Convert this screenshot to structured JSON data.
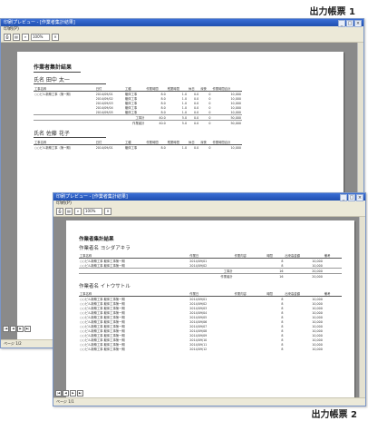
{
  "caption_top": "出力帳票 1",
  "caption_bottom": "出力帳票 2",
  "win1": {
    "title": "印刷プレビュー - [作業者集計結果]",
    "menu": "印刷(P)",
    "zoom": "100%",
    "report_title": "作業者集計結果",
    "section1_name": "氏名  田中  太一",
    "section2_name": "氏名  佐藤  花子",
    "columns": [
      "工事名称",
      "日付",
      "工種",
      "作業時間",
      "残業時間",
      "休日",
      "深夜",
      "作業時間合計"
    ],
    "rows": [
      [
        "○○ビル新築工事（第一期）",
        "2014/09/01",
        "躯体工事",
        "8.0",
        "1.0",
        "0.0",
        "0",
        "10,000"
      ],
      [
        "",
        "2014/09/02",
        "躯体工事",
        "8.0",
        "1.0",
        "0.0",
        "0",
        "10,000"
      ],
      [
        "",
        "2014/09/03",
        "躯体工事",
        "8.0",
        "1.0",
        "0.0",
        "0",
        "10,000"
      ],
      [
        "",
        "2014/09/04",
        "躯体工事",
        "8.0",
        "1.0",
        "0.0",
        "0",
        "10,000"
      ],
      [
        "",
        "2014/09/05",
        "躯体工事",
        "8.0",
        "1.0",
        "0.0",
        "0",
        "10,000"
      ]
    ],
    "subtotal_label": "工事計",
    "total_label": "作業者計",
    "subtotal": [
      "40.0",
      "5.0",
      "0.0",
      "0",
      "50,000"
    ],
    "total": [
      "40.0",
      "5.0",
      "0.0",
      "0",
      "50,000"
    ],
    "sec2_row": [
      "○○ビル新築工事（第一期）",
      "2014/09/01",
      "躯体工事",
      "8.0",
      "1.0",
      "0.0",
      "0",
      "10,000"
    ],
    "status": "ページ 1/2"
  },
  "win2": {
    "title": "印刷プレビュー - [作業者集計結果]",
    "menu": "印刷(P)",
    "zoom": "100%",
    "report_title": "作業者集計結果",
    "section1_name": "作業者名   ヨシダアキラ",
    "section2_name": "作業者名   イトウサトル",
    "columns": [
      "工事名称",
      "作業日",
      "作業内容",
      "時間",
      "出来高金額",
      "備考"
    ],
    "rows1": [
      [
        "○○ビル新築工事 躯体工事第一期",
        "2014/09/01",
        "",
        "8",
        "10,000",
        ""
      ],
      [
        "○○ビル新築工事 躯体工事第一期",
        "2014/09/02",
        "",
        "8",
        "10,000",
        ""
      ]
    ],
    "sub1_label": "工事計",
    "sub1": [
      "",
      "16",
      "20,000",
      ""
    ],
    "total1_label": "作業者計",
    "total1": [
      "",
      "16",
      "20,000",
      ""
    ],
    "rows2": [
      [
        "○○ビル新築工事 躯体工事第一期",
        "2014/09/01",
        "",
        "8",
        "10,000",
        ""
      ],
      [
        "○○ビル新築工事 躯体工事第一期",
        "2014/09/02",
        "",
        "8",
        "10,000",
        ""
      ],
      [
        "○○ビル新築工事 躯体工事第一期",
        "2014/09/03",
        "",
        "8",
        "10,000",
        ""
      ],
      [
        "○○ビル新築工事 躯体工事第一期",
        "2014/09/04",
        "",
        "8",
        "10,000",
        ""
      ],
      [
        "○○ビル新築工事 躯体工事第一期",
        "2014/09/05",
        "",
        "8",
        "10,000",
        ""
      ],
      [
        "○○ビル新築工事 躯体工事第一期",
        "2014/09/06",
        "",
        "8",
        "10,000",
        ""
      ],
      [
        "○○ビル新築工事 躯体工事第一期",
        "2014/09/07",
        "",
        "8",
        "10,000",
        ""
      ],
      [
        "○○ビル新築工事 躯体工事第一期",
        "2014/09/08",
        "",
        "8",
        "10,000",
        ""
      ],
      [
        "○○ビル新築工事 躯体工事第一期",
        "2014/09/09",
        "",
        "8",
        "10,000",
        ""
      ],
      [
        "○○ビル新築工事 躯体工事第一期",
        "2014/09/10",
        "",
        "8",
        "10,000",
        ""
      ],
      [
        "○○ビル新築工事 躯体工事第一期",
        "2014/09/11",
        "",
        "8",
        "10,000",
        ""
      ],
      [
        "○○ビル新築工事 躯体工事第一期",
        "2014/09/12",
        "",
        "8",
        "10,000",
        ""
      ]
    ],
    "status": "ページ 1/1"
  }
}
